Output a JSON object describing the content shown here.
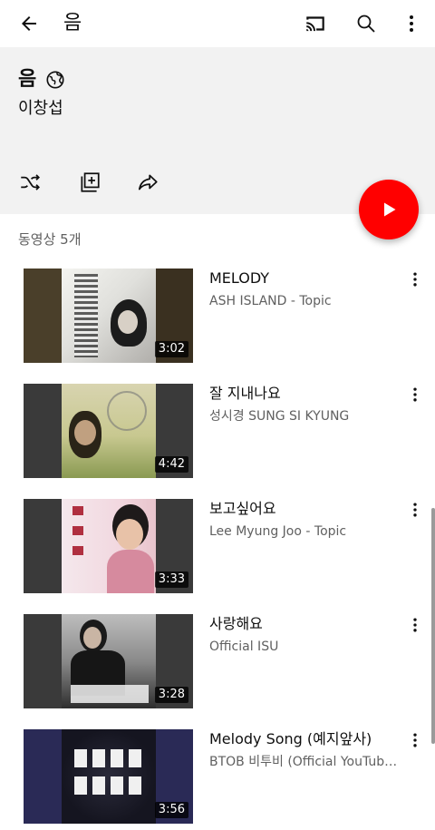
{
  "appbar": {
    "title": "음",
    "back_icon": "arrow-back-icon",
    "cast_icon": "cast-icon",
    "search_icon": "search-icon",
    "more_icon": "more-vert-icon"
  },
  "playlist": {
    "title": "음",
    "visibility_icon": "globe-public-icon",
    "owner": "이창섭",
    "actions": [
      "shuffle-icon",
      "save-to-library-icon",
      "share-icon"
    ],
    "play_icon": "play-icon",
    "video_count": "동영상 5개"
  },
  "videos": [
    {
      "title": "MELODY",
      "channel": "ASH ISLAND - Topic",
      "duration": "3:02"
    },
    {
      "title": "잘 지내나요",
      "channel": "성시경 SUNG SI KYUNG",
      "duration": "4:42"
    },
    {
      "title": "보고싶어요",
      "channel": "Lee Myung Joo  - Topic",
      "duration": "3:33"
    },
    {
      "title": "사랑해요",
      "channel": "Official ISU",
      "duration": "3:28"
    },
    {
      "title": "Melody Song (예지앞사)",
      "channel": "BTOB 비투비 (Official YouTube Channel)",
      "duration": "3:56"
    }
  ],
  "colors": {
    "accent": "#ff0000",
    "header_bg": "#f2f2f2",
    "secondary_text": "#606060"
  }
}
